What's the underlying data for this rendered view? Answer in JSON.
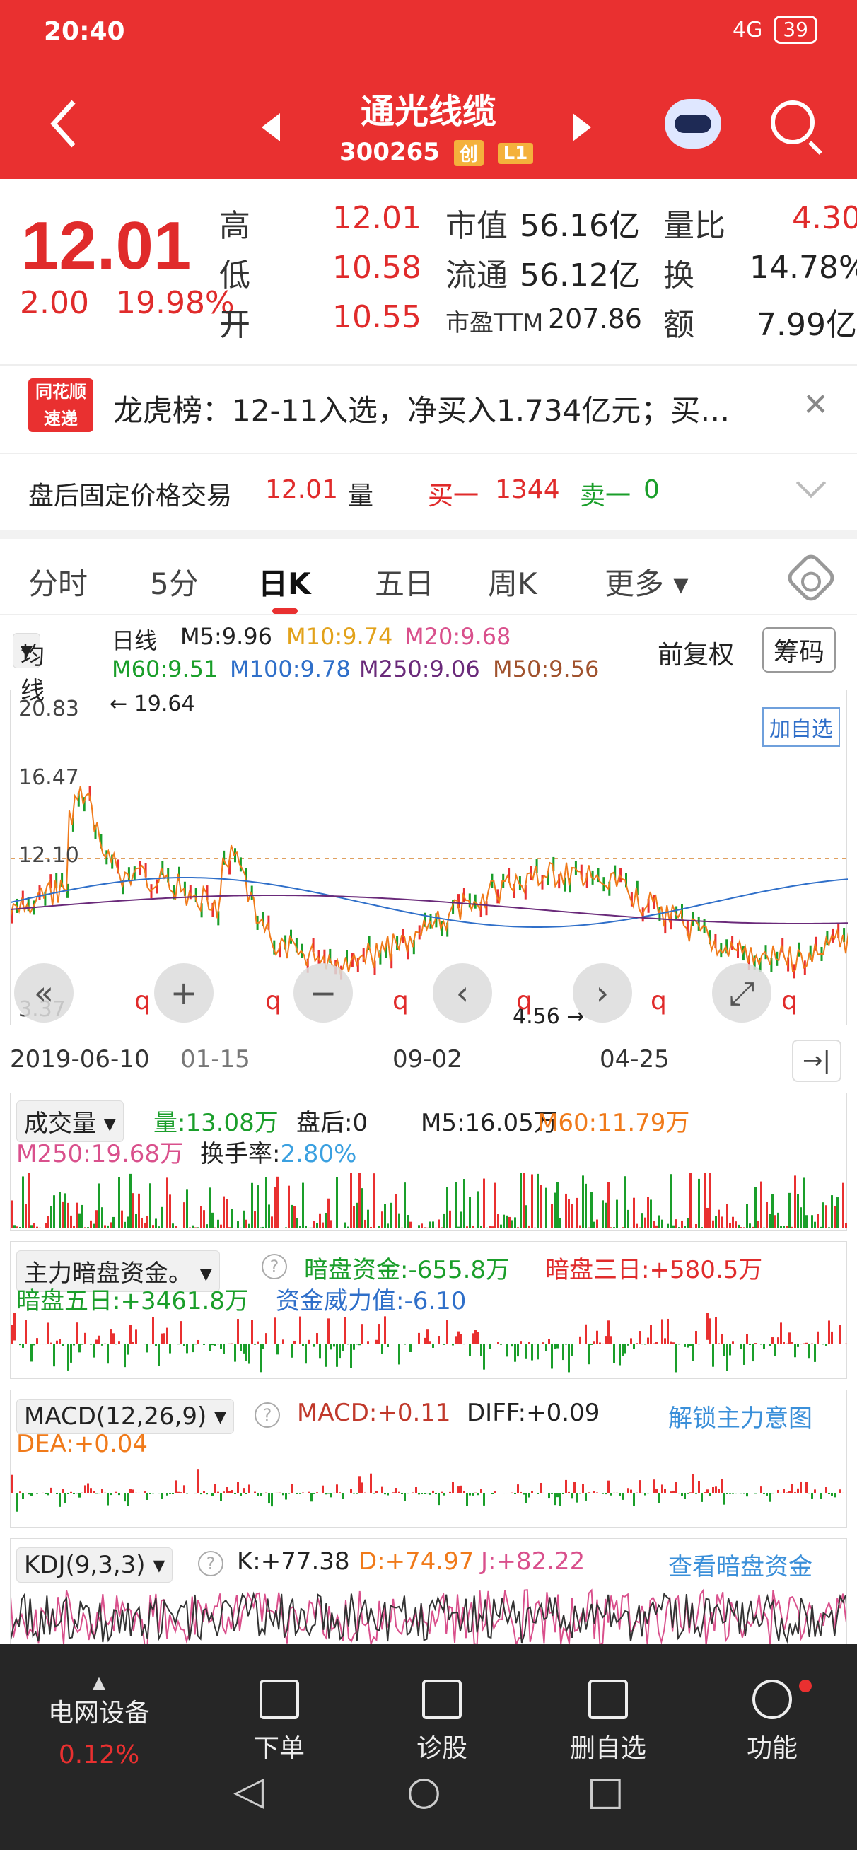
{
  "status_bar": {
    "time": "20:40",
    "icons": "NFC alarm",
    "signal": "4G",
    "battery": "39"
  },
  "header": {
    "stock_name": "通光线缆",
    "stock_code": "300265",
    "badge_chuang": "创",
    "badge_level": "L1"
  },
  "quote": {
    "price": "12.01",
    "change": "2.00",
    "change_pct": "19.98%",
    "high_label": "高",
    "high": "12.01",
    "low_label": "低",
    "low": "10.58",
    "open_label": "开",
    "open": "10.55",
    "mcap_label": "市值",
    "mcap": "56.16亿",
    "float_label": "流通",
    "float": "56.12亿",
    "pe_label": "市盈TTM",
    "pe": "207.86",
    "vol_ratio_label": "量比",
    "vol_ratio": "4.30",
    "turnover_label": "换",
    "turnover": "14.78%",
    "amount_label": "额",
    "amount": "7.99亿"
  },
  "news": {
    "logo_line1": "同花顺",
    "logo_line2": "速递",
    "text": "龙虎榜：12-11入选，净买入1.734亿元；买…"
  },
  "afterhours": {
    "label": "盘后固定价格交易",
    "price": "12.01",
    "vol_label": "量",
    "bid_label": "买一",
    "bid": "1344",
    "ask_label": "卖一",
    "ask": "0"
  },
  "tabs": [
    "分时",
    "5分",
    "日K",
    "五日",
    "周K",
    "更多"
  ],
  "ma": {
    "selector": "均线",
    "type": "日线",
    "m5": "M5:9.96",
    "m10": "M10:9.74",
    "m20": "M20:9.68",
    "m60": "M60:9.51",
    "m100": "M100:9.78",
    "m250": "M250:9.06",
    "m50": "M50:9.56",
    "adj": "前复权",
    "chip": "筹码"
  },
  "chart_labels": {
    "y_top": "20.83",
    "y_mid1": "16.47",
    "y_mid2": "12.10",
    "y_bottom": "3.37",
    "max_note": "19.64",
    "min_note": "4.56",
    "add_fav": "加自选",
    "marker": "q"
  },
  "dates": {
    "d1": "2019-06-10",
    "d2": "01-15",
    "d3": "09-02",
    "d4": "04-25"
  },
  "volume": {
    "selector": "成交量",
    "vol": "量:13.08万",
    "after": "盘后:0",
    "m5": "M5:16.05万",
    "m60": "M60:11.79万",
    "m250": "M250:19.68万",
    "turn_label": "换手率:",
    "turn": "2.80%"
  },
  "dark": {
    "selector": "主力暗盘资金。",
    "fund": "暗盘资金:-655.8万",
    "three": "暗盘三日:+580.5万",
    "five": "暗盘五日:+3461.8万",
    "power": "资金威力值:-6.10"
  },
  "macd": {
    "selector": "MACD(12,26,9)",
    "macd": "MACD:+0.11",
    "diff": "DIFF:+0.09",
    "dea": "DEA:+0.04",
    "unlock": "解锁主力意图"
  },
  "kdj": {
    "selector": "KDJ(9,3,3)",
    "k": "K:+77.38",
    "d": "D:+74.97",
    "j": "J:+82.22",
    "view": "查看暗盘资金"
  },
  "bottom_nav": {
    "sector": "电网设备",
    "sector_pct": "0.12%",
    "order": "下单",
    "diagnose": "诊股",
    "remove": "删自选",
    "func": "功能"
  },
  "colors": {
    "red": "#e93030",
    "green": "#1a9e2a",
    "orange": "#f07a1a",
    "blue": "#2f6fc9"
  }
}
